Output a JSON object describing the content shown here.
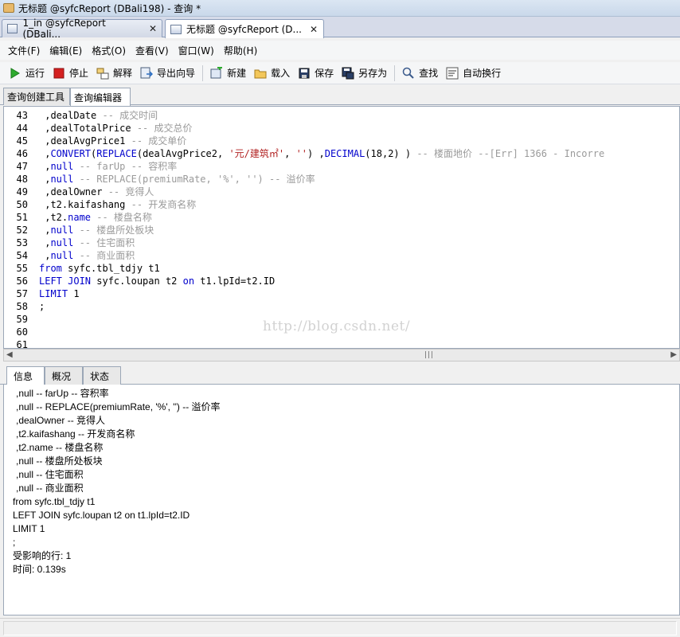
{
  "window": {
    "title": "无标题 @syfcReport (DBali198) - 查询 *"
  },
  "doc_tabs": [
    {
      "label": "1_in @syfcReport (DBali...",
      "close": "✕"
    },
    {
      "label": "无标题 @syfcReport (D...",
      "close": "✕"
    }
  ],
  "menu": [
    "文件(F)",
    "编辑(E)",
    "格式(O)",
    "查看(V)",
    "窗口(W)",
    "帮助(H)"
  ],
  "toolbar": {
    "run": "运行",
    "stop": "停止",
    "explain": "解释",
    "export": "导出向导",
    "new": "新建",
    "load": "载入",
    "save": "保存",
    "save_as": "另存为",
    "find": "查找",
    "wrap": "自动换行"
  },
  "subtabs": [
    "查询创建工具",
    "查询编辑器"
  ],
  "editor_lines": [
    {
      "n": "43",
      "segs": [
        {
          "t": " ,dealDate ",
          "c": "pl"
        },
        {
          "t": "-- 成交时间",
          "c": "cm"
        }
      ]
    },
    {
      "n": "44",
      "segs": [
        {
          "t": " ,dealTotalPrice ",
          "c": "pl"
        },
        {
          "t": "-- 成交总价",
          "c": "cm"
        }
      ]
    },
    {
      "n": "45",
      "segs": [
        {
          "t": " ,dealAvgPrice1 ",
          "c": "pl"
        },
        {
          "t": "-- 成交单价",
          "c": "cm"
        }
      ]
    },
    {
      "n": "46",
      "segs": [
        {
          "t": " ,",
          "c": "pl"
        },
        {
          "t": "CONVERT",
          "c": "kw"
        },
        {
          "t": "(",
          "c": "pl"
        },
        {
          "t": "REPLACE",
          "c": "kw"
        },
        {
          "t": "(dealAvgPrice2, ",
          "c": "pl"
        },
        {
          "t": "'元/建筑㎡'",
          "c": "str"
        },
        {
          "t": ", ",
          "c": "pl"
        },
        {
          "t": "''",
          "c": "str"
        },
        {
          "t": ") ,",
          "c": "pl"
        },
        {
          "t": "DECIMAL",
          "c": "kw"
        },
        {
          "t": "(18,2) ) ",
          "c": "pl"
        },
        {
          "t": "-- 楼面地价 --[Err] 1366 - Incorre",
          "c": "cm"
        }
      ]
    },
    {
      "n": "47",
      "segs": [
        {
          "t": " ,",
          "c": "pl"
        },
        {
          "t": "null",
          "c": "kw"
        },
        {
          "t": " -- farUp -- 容积率",
          "c": "cm"
        }
      ]
    },
    {
      "n": "48",
      "segs": [
        {
          "t": " ,",
          "c": "pl"
        },
        {
          "t": "null",
          "c": "kw"
        },
        {
          "t": " -- REPLACE(premiumRate, '%', '') -- 溢价率",
          "c": "cm"
        }
      ]
    },
    {
      "n": "49",
      "segs": [
        {
          "t": " ,dealOwner ",
          "c": "pl"
        },
        {
          "t": "-- 竞得人",
          "c": "cm"
        }
      ]
    },
    {
      "n": "50",
      "segs": [
        {
          "t": " ,t2.kaifashang ",
          "c": "pl"
        },
        {
          "t": "-- 开发商名称",
          "c": "cm"
        }
      ]
    },
    {
      "n": "51",
      "segs": [
        {
          "t": " ,t2.",
          "c": "pl"
        },
        {
          "t": "name",
          "c": "kw"
        },
        {
          "t": " -- 楼盘名称",
          "c": "cm"
        }
      ]
    },
    {
      "n": "52",
      "segs": [
        {
          "t": " ,",
          "c": "pl"
        },
        {
          "t": "null",
          "c": "kw"
        },
        {
          "t": " -- 楼盘所处板块",
          "c": "cm"
        }
      ]
    },
    {
      "n": "53",
      "segs": [
        {
          "t": " ,",
          "c": "pl"
        },
        {
          "t": "null",
          "c": "kw"
        },
        {
          "t": " -- 住宅面积",
          "c": "cm"
        }
      ]
    },
    {
      "n": "54",
      "segs": [
        {
          "t": " ,",
          "c": "pl"
        },
        {
          "t": "null",
          "c": "kw"
        },
        {
          "t": " -- 商业面积",
          "c": "cm"
        }
      ]
    },
    {
      "n": "55",
      "segs": [
        {
          "t": "from",
          "c": "kw"
        },
        {
          "t": " syfc.tbl_tdjy t1",
          "c": "pl"
        }
      ]
    },
    {
      "n": "56",
      "segs": [
        {
          "t": "LEFT JOIN",
          "c": "kw"
        },
        {
          "t": " syfc.loupan t2 ",
          "c": "pl"
        },
        {
          "t": "on",
          "c": "kw"
        },
        {
          "t": " t1.lpId=t2.ID",
          "c": "pl"
        }
      ]
    },
    {
      "n": "57",
      "segs": [
        {
          "t": "LIMIT",
          "c": "kw"
        },
        {
          "t": " 1",
          "c": "pl"
        }
      ]
    },
    {
      "n": "58",
      "segs": [
        {
          "t": ";",
          "c": "pl"
        }
      ]
    },
    {
      "n": "59",
      "segs": []
    },
    {
      "n": "60",
      "segs": []
    },
    {
      "n": "61",
      "segs": []
    }
  ],
  "watermark": "http://blog.csdn.net/",
  "bottom_tabs": [
    "信息",
    "概况",
    "状态"
  ],
  "info_lines": [
    ",null -- farUp -- 容积率",
    ",null -- REPLACE(premiumRate, '%', '') -- 溢价率",
    ",dealOwner -- 竞得人",
    ",t2.kaifashang -- 开发商名称",
    ",t2.name -- 楼盘名称",
    ",null -- 楼盘所处板块",
    ",null -- 住宅面积",
    ",null -- 商业面积",
    "from syfc.tbl_tdjy t1",
    "LEFT JOIN syfc.loupan t2 on t1.lpId=t2.ID",
    "LIMIT 1",
    ";",
    "受影响的行: 1",
    "时间: 0.139s"
  ]
}
